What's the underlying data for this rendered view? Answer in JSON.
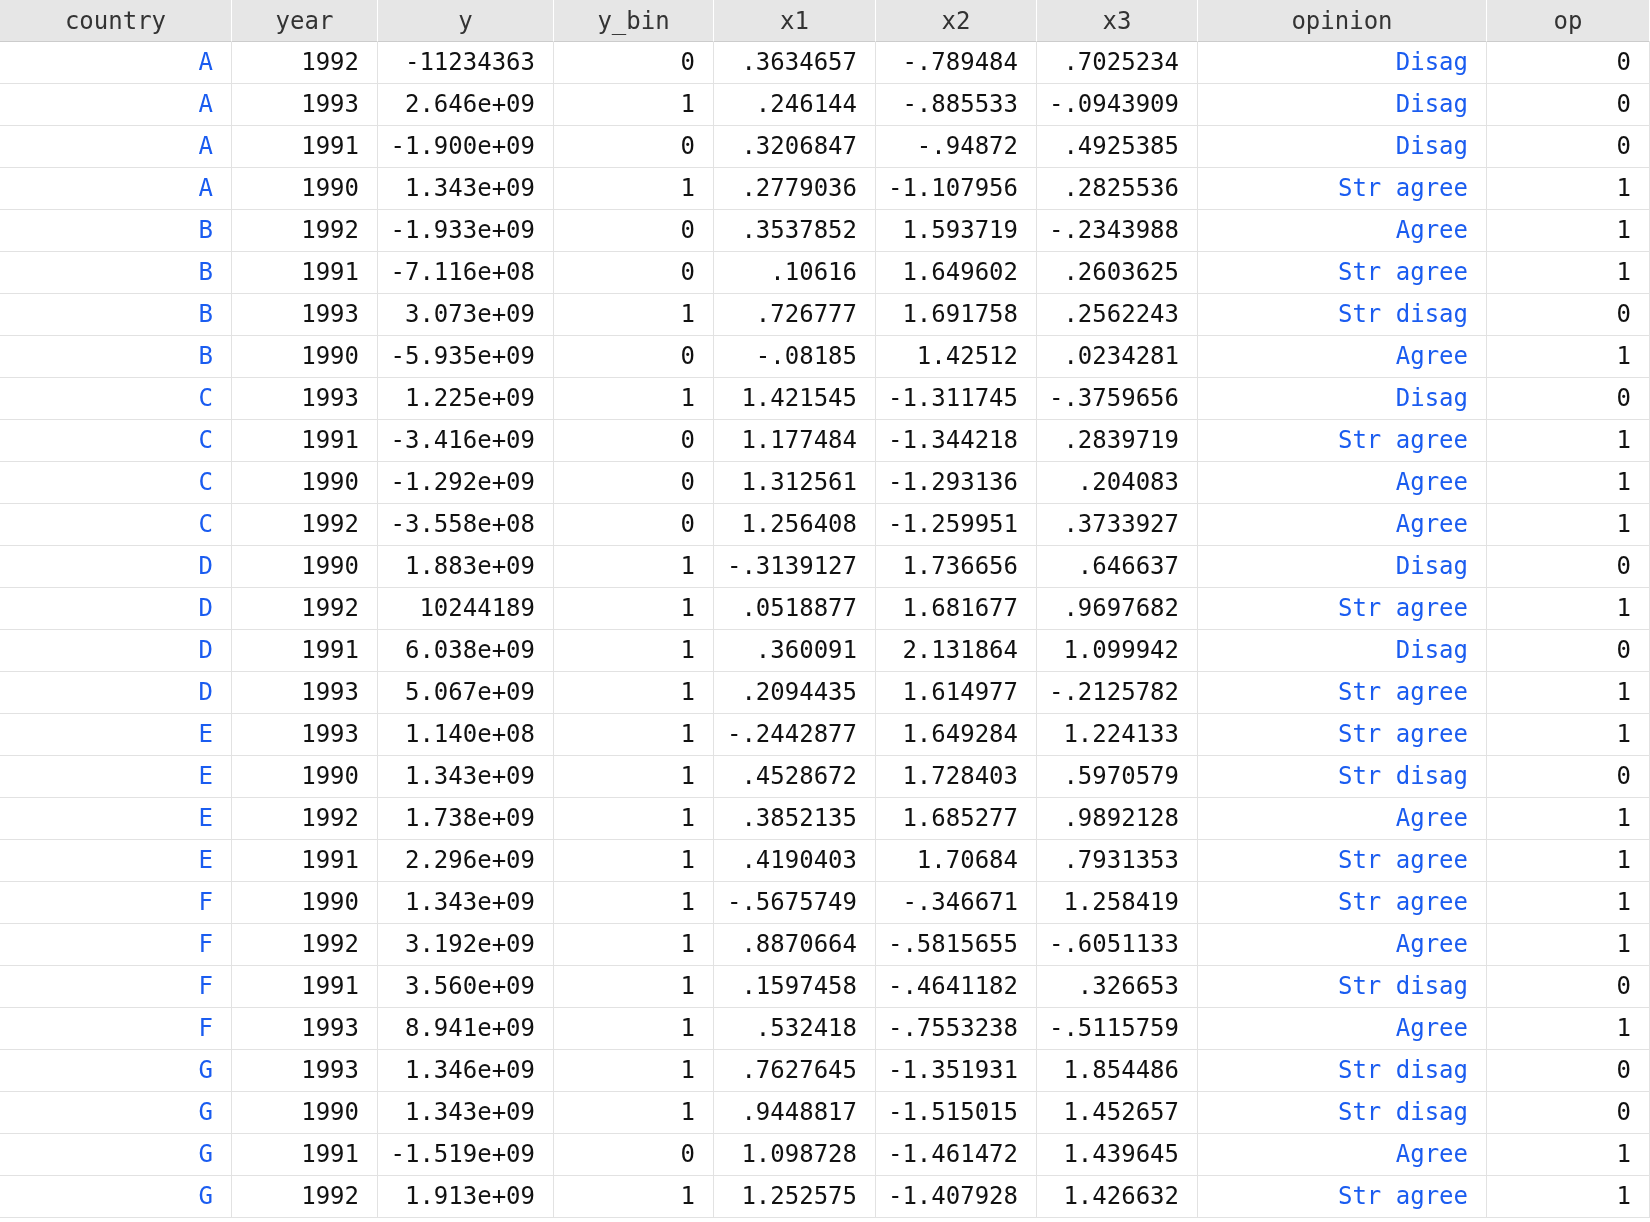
{
  "table": {
    "columns": [
      {
        "name": "country",
        "labeled": true
      },
      {
        "name": "year",
        "labeled": false
      },
      {
        "name": "y",
        "labeled": false
      },
      {
        "name": "y_bin",
        "labeled": false
      },
      {
        "name": "x1",
        "labeled": false
      },
      {
        "name": "x2",
        "labeled": false
      },
      {
        "name": "x3",
        "labeled": false
      },
      {
        "name": "opinion",
        "labeled": true
      },
      {
        "name": "op",
        "labeled": false
      }
    ],
    "rows": [
      [
        "A",
        "1992",
        "-11234363",
        "0",
        ".3634657",
        "-.789484",
        ".7025234",
        "Disag",
        "0"
      ],
      [
        "A",
        "1993",
        "2.646e+09",
        "1",
        ".246144",
        "-.885533",
        "-.0943909",
        "Disag",
        "0"
      ],
      [
        "A",
        "1991",
        "-1.900e+09",
        "0",
        ".3206847",
        "-.94872",
        ".4925385",
        "Disag",
        "0"
      ],
      [
        "A",
        "1990",
        "1.343e+09",
        "1",
        ".2779036",
        "-1.107956",
        ".2825536",
        "Str agree",
        "1"
      ],
      [
        "B",
        "1992",
        "-1.933e+09",
        "0",
        ".3537852",
        "1.593719",
        "-.2343988",
        "Agree",
        "1"
      ],
      [
        "B",
        "1991",
        "-7.116e+08",
        "0",
        ".10616",
        "1.649602",
        ".2603625",
        "Str agree",
        "1"
      ],
      [
        "B",
        "1993",
        "3.073e+09",
        "1",
        ".726777",
        "1.691758",
        ".2562243",
        "Str disag",
        "0"
      ],
      [
        "B",
        "1990",
        "-5.935e+09",
        "0",
        "-.08185",
        "1.42512",
        ".0234281",
        "Agree",
        "1"
      ],
      [
        "C",
        "1993",
        "1.225e+09",
        "1",
        "1.421545",
        "-1.311745",
        "-.3759656",
        "Disag",
        "0"
      ],
      [
        "C",
        "1991",
        "-3.416e+09",
        "0",
        "1.177484",
        "-1.344218",
        ".2839719",
        "Str agree",
        "1"
      ],
      [
        "C",
        "1990",
        "-1.292e+09",
        "0",
        "1.312561",
        "-1.293136",
        ".204083",
        "Agree",
        "1"
      ],
      [
        "C",
        "1992",
        "-3.558e+08",
        "0",
        "1.256408",
        "-1.259951",
        ".3733927",
        "Agree",
        "1"
      ],
      [
        "D",
        "1990",
        "1.883e+09",
        "1",
        "-.3139127",
        "1.736656",
        ".646637",
        "Disag",
        "0"
      ],
      [
        "D",
        "1992",
        "10244189",
        "1",
        ".0518877",
        "1.681677",
        ".9697682",
        "Str agree",
        "1"
      ],
      [
        "D",
        "1991",
        "6.038e+09",
        "1",
        ".360091",
        "2.131864",
        "1.099942",
        "Disag",
        "0"
      ],
      [
        "D",
        "1993",
        "5.067e+09",
        "1",
        ".2094435",
        "1.614977",
        "-.2125782",
        "Str agree",
        "1"
      ],
      [
        "E",
        "1993",
        "1.140e+08",
        "1",
        "-.2442877",
        "1.649284",
        "1.224133",
        "Str agree",
        "1"
      ],
      [
        "E",
        "1990",
        "1.343e+09",
        "1",
        ".4528672",
        "1.728403",
        ".5970579",
        "Str disag",
        "0"
      ],
      [
        "E",
        "1992",
        "1.738e+09",
        "1",
        ".3852135",
        "1.685277",
        ".9892128",
        "Agree",
        "1"
      ],
      [
        "E",
        "1991",
        "2.296e+09",
        "1",
        ".4190403",
        "1.70684",
        ".7931353",
        "Str agree",
        "1"
      ],
      [
        "F",
        "1990",
        "1.343e+09",
        "1",
        "-.5675749",
        "-.346671",
        "1.258419",
        "Str agree",
        "1"
      ],
      [
        "F",
        "1992",
        "3.192e+09",
        "1",
        ".8870664",
        "-.5815655",
        "-.6051133",
        "Agree",
        "1"
      ],
      [
        "F",
        "1991",
        "3.560e+09",
        "1",
        ".1597458",
        "-.4641182",
        ".326653",
        "Str disag",
        "0"
      ],
      [
        "F",
        "1993",
        "8.941e+09",
        "1",
        ".532418",
        "-.7553238",
        "-.5115759",
        "Agree",
        "1"
      ],
      [
        "G",
        "1993",
        "1.346e+09",
        "1",
        ".7627645",
        "-1.351931",
        "1.854486",
        "Str disag",
        "0"
      ],
      [
        "G",
        "1990",
        "1.343e+09",
        "1",
        ".9448817",
        "-1.515015",
        "1.452657",
        "Str disag",
        "0"
      ],
      [
        "G",
        "1991",
        "-1.519e+09",
        "0",
        "1.098728",
        "-1.461472",
        "1.439645",
        "Agree",
        "1"
      ],
      [
        "G",
        "1992",
        "1.913e+09",
        "1",
        "1.252575",
        "-1.407928",
        "1.426632",
        "Str agree",
        "1"
      ]
    ]
  }
}
